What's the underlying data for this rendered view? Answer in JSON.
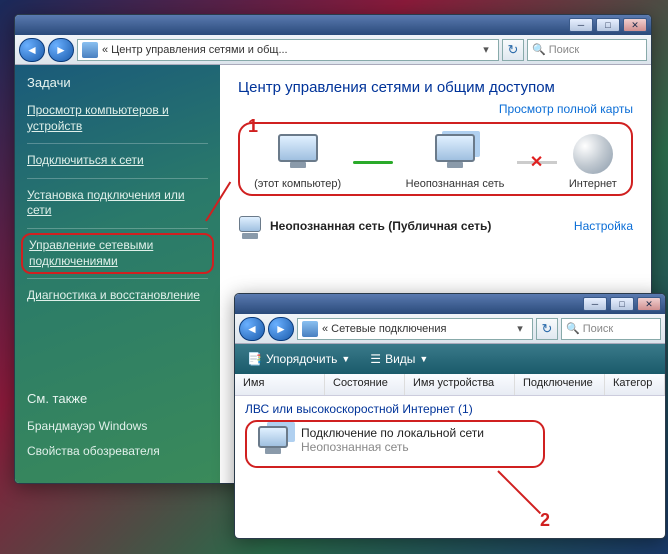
{
  "window1": {
    "breadcrumb": "« Центр управления сетями и общ...",
    "search_placeholder": "Поиск",
    "title": "Центр управления сетями и общим доступом",
    "view_map": "Просмотр полной карты",
    "sidebar": {
      "heading": "Задачи",
      "links": [
        "Просмотр компьютеров и устройств",
        "Подключиться к сети",
        "Установка подключения или сети",
        "Управление сетевыми подключениями",
        "Диагностика и восстановление"
      ],
      "footer_heading": "См. также",
      "footer_links": [
        "Брандмауэр Windows",
        "Свойства обозревателя"
      ]
    },
    "network_map": {
      "nodes": [
        "(этот компьютер)",
        "Неопознанная сеть",
        "Интернет"
      ]
    },
    "network_row": {
      "label": "Неопознанная сеть (Публичная сеть)",
      "action": "Настройка"
    }
  },
  "window2": {
    "breadcrumb": "« Сетевые подключения",
    "search_placeholder": "Поиск",
    "toolbar": {
      "organize": "Упорядочить",
      "views": "Виды"
    },
    "columns": [
      "Имя",
      "Состояние",
      "Имя устройства",
      "Подключение",
      "Категор"
    ],
    "group": "ЛВС или высокоскоростной Интернет (1)",
    "connection": {
      "name": "Подключение по локальной сети",
      "status": "Неопознанная сеть"
    }
  },
  "annotations": {
    "a1": "1",
    "a2": "2"
  }
}
